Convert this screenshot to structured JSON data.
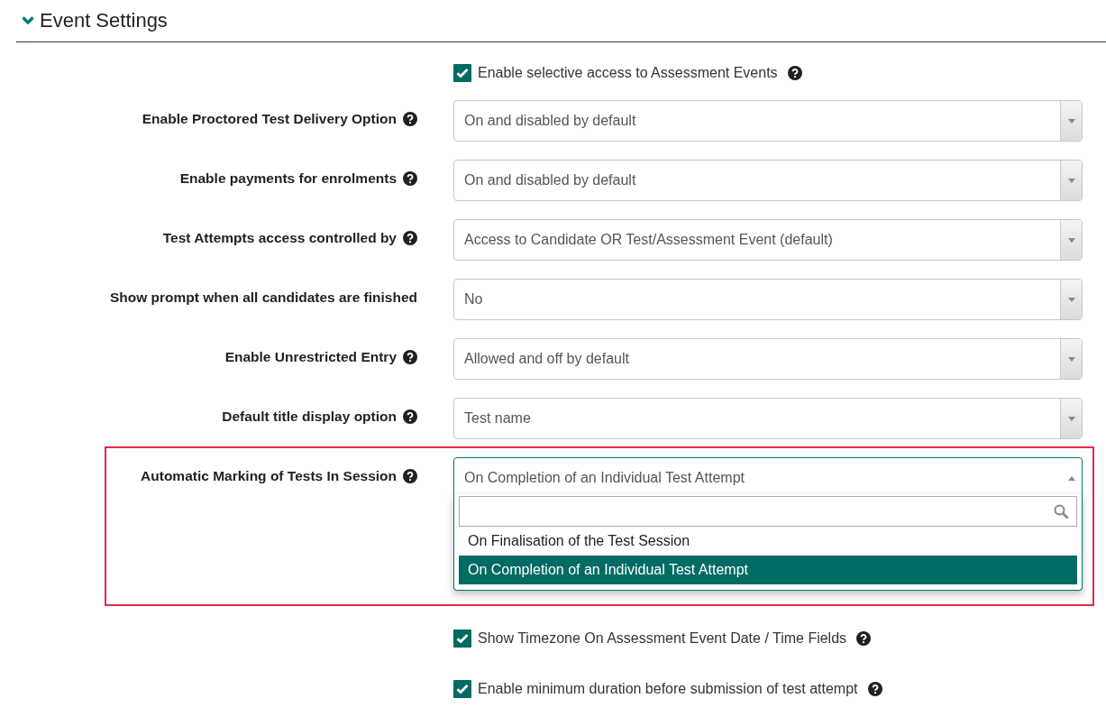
{
  "section": {
    "title": "Event Settings",
    "expanded": true
  },
  "settings": [
    {
      "kind": "checkbox",
      "label": "Enable selective access to Assessment Events",
      "checked": true,
      "help": true
    },
    {
      "kind": "select",
      "label": "Enable Proctored Test Delivery Option",
      "value": "On and disabled by default",
      "help": true,
      "open": false
    },
    {
      "kind": "select",
      "label": "Enable payments for enrolments",
      "value": "On and disabled by default",
      "help": true,
      "open": false
    },
    {
      "kind": "select",
      "label": "Test Attempts access controlled by",
      "value": "Access to Candidate OR Test/Assessment Event (default)",
      "help": true,
      "open": false
    },
    {
      "kind": "select",
      "label": "Show prompt when all candidates are finished",
      "value": "No",
      "help": false,
      "open": false
    },
    {
      "kind": "select",
      "label": "Enable Unrestricted Entry",
      "value": "Allowed and off by default",
      "help": true,
      "open": false
    },
    {
      "kind": "select",
      "label": "Default title display option",
      "value": "Test name",
      "help": true,
      "open": false
    },
    {
      "kind": "select",
      "label": "Automatic Marking of Tests In Session",
      "value": "On Completion of an Individual Test Attempt",
      "help": true,
      "open": true,
      "highlighted": true,
      "options": [
        {
          "label": "On Finalisation of the Test Session",
          "selected": false
        },
        {
          "label": "On Completion of an Individual Test Attempt",
          "selected": true
        }
      ]
    },
    {
      "kind": "checkbox",
      "label": "Show Timezone On Assessment Event Date / Time Fields",
      "checked": true,
      "help": true
    },
    {
      "kind": "checkbox",
      "label": "Enable minimum duration before submission of test attempt",
      "checked": true,
      "help": true
    }
  ]
}
